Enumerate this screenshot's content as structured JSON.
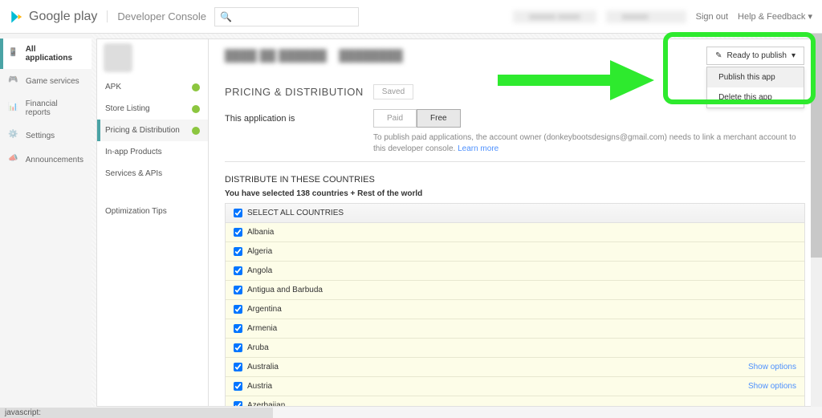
{
  "header": {
    "logo_text": "Google play",
    "console_text": "Developer Console",
    "signout": "Sign out",
    "help": "Help & Feedback ▾"
  },
  "left_nav": {
    "items": [
      {
        "label": "All applications",
        "active": true
      },
      {
        "label": "Game services",
        "active": false
      },
      {
        "label": "Financial reports",
        "active": false
      },
      {
        "label": "Settings",
        "active": false
      },
      {
        "label": "Announcements",
        "active": false
      }
    ]
  },
  "app_nav": {
    "items": [
      {
        "label": "APK",
        "check": true,
        "active": false
      },
      {
        "label": "Store Listing",
        "check": true,
        "active": false
      },
      {
        "label": "Pricing & Distribution",
        "check": true,
        "active": true
      },
      {
        "label": "In-app Products",
        "check": false,
        "active": false
      },
      {
        "label": "Services & APIs",
        "check": false,
        "active": false
      }
    ],
    "optimization": "Optimization Tips"
  },
  "section": {
    "title": "PRICING & DISTRIBUTION",
    "saved": "Saved",
    "app_is_label": "This application is",
    "paid": "Paid",
    "free": "Free",
    "help_text": "To publish paid applications, the account owner (donkeybootsdesigns@gmail.com) needs to link a merchant account to this developer console.",
    "learn_more": "Learn more"
  },
  "countries": {
    "title": "DISTRIBUTE IN THESE COUNTRIES",
    "subtitle": "You have selected 138 countries + Rest of the world",
    "select_all": "SELECT ALL COUNTRIES",
    "show_options": "Show options",
    "list": [
      "Albania",
      "Algeria",
      "Angola",
      "Antigua and Barbuda",
      "Argentina",
      "Armenia",
      "Aruba",
      "Australia",
      "Austria",
      "Azerbaijan"
    ],
    "options_at": [
      7,
      8
    ]
  },
  "publish": {
    "button": "Ready to publish",
    "menu": [
      "Publish this app",
      "Delete this app"
    ]
  },
  "status_bar": "javascript:"
}
